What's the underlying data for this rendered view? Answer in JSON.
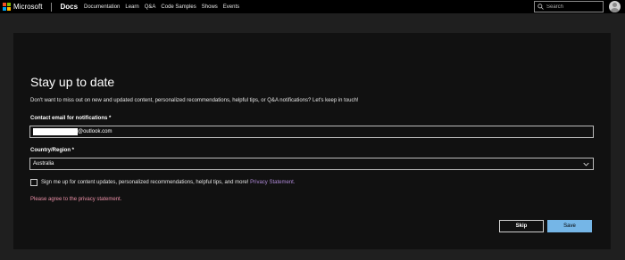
{
  "header": {
    "brand": "Microsoft",
    "product": "Docs",
    "nav": [
      "Documentation",
      "Learn",
      "Q&A",
      "Code Samples",
      "Shows",
      "Events"
    ],
    "search_placeholder": "Search",
    "logo_colors": [
      "#f25022",
      "#7fba00",
      "#00a4ef",
      "#ffb900"
    ]
  },
  "form": {
    "title": "Stay up to date",
    "subtitle": "Don't want to miss out on new and updated content, personalized recommendations, helpful tips, or Q&A notifications? Let's keep in touch!",
    "email_label": "Contact email for notifications *",
    "email_suffix": "@outlook.com",
    "country_label": "Country/Region *",
    "country_value": "Australia",
    "consent_text": "Sign me up for content updates, personalized recommendations, helpful tips, and more! ",
    "consent_link": "Privacy Statement.",
    "consent_checked": false,
    "error": "Please agree to the privacy statement.",
    "skip_label": "Skip",
    "save_label": "Save"
  },
  "colors": {
    "accent": "#75b6e7",
    "link": "#b08ad9",
    "error": "#ea8fa6"
  },
  "icons": {
    "search": "search-icon",
    "dropdown": "chevron-down-icon",
    "avatar": "user-avatar-icon"
  }
}
